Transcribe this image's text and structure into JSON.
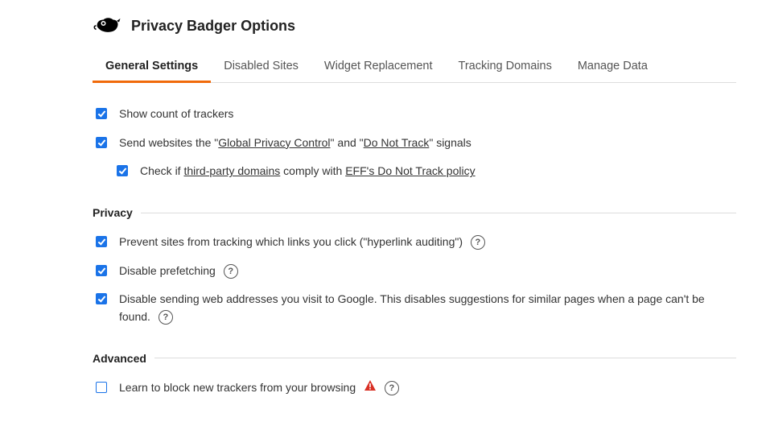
{
  "header": {
    "title": "Privacy Badger Options"
  },
  "tabs": [
    {
      "label": "General Settings",
      "active": true
    },
    {
      "label": "Disabled Sites"
    },
    {
      "label": "Widget Replacement"
    },
    {
      "label": "Tracking Domains"
    },
    {
      "label": "Manage Data"
    }
  ],
  "options": {
    "show_count": {
      "label": "Show count of trackers",
      "checked": true
    },
    "send_signals": {
      "pre": "Send websites the \"",
      "link1": "Global Privacy Control",
      "mid": "\" and \"",
      "link2": "Do Not Track",
      "post": "\" signals",
      "checked": true
    },
    "check_comply": {
      "pre": "Check if ",
      "link1": "third-party domains",
      "mid": " comply with ",
      "link2": "EFF's Do Not Track policy",
      "checked": true
    }
  },
  "sections": {
    "privacy": {
      "title": "Privacy",
      "prevent_hyperlink": {
        "label": "Prevent sites from tracking which links you click (\"hyperlink auditing\")",
        "checked": true
      },
      "disable_prefetching": {
        "label": "Disable prefetching",
        "checked": true
      },
      "disable_google": {
        "label": "Disable sending web addresses you visit to Google. This disables suggestions for similar pages when a page can't be found.",
        "checked": true
      }
    },
    "advanced": {
      "title": "Advanced",
      "learn_block": {
        "label": "Learn to block new trackers from your browsing",
        "checked": false
      }
    }
  }
}
